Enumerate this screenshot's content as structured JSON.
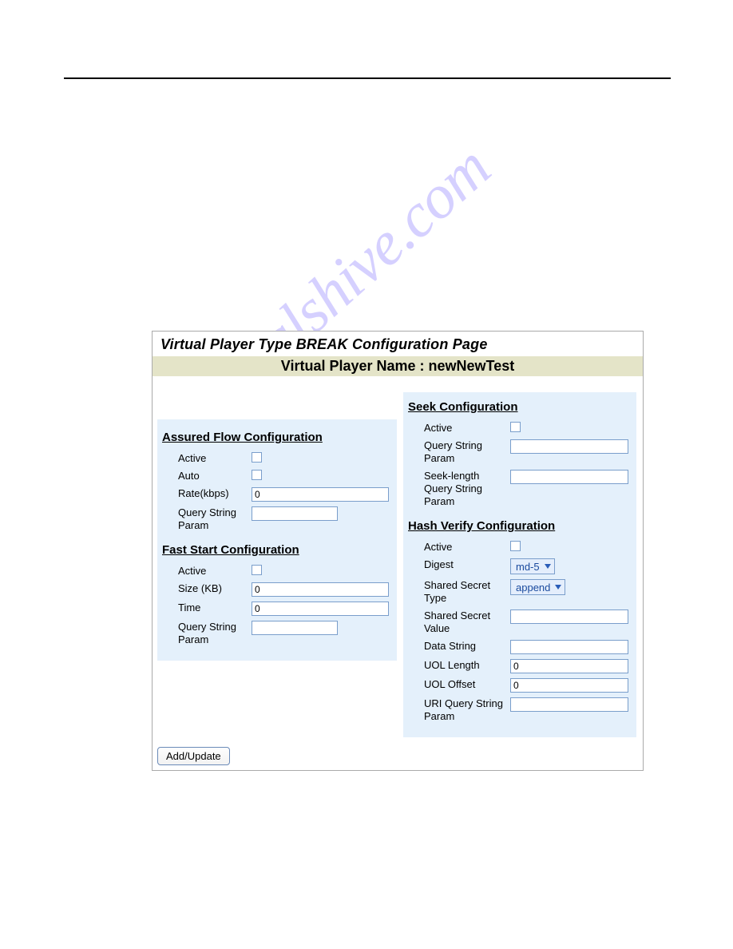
{
  "watermark": "manualshive.com",
  "panel": {
    "title": "Virtual Player Type BREAK Configuration Page",
    "player_name": "Virtual Player Name : newNewTest"
  },
  "assured": {
    "heading": "Assured Flow Configuration",
    "labels": {
      "active": "Active",
      "auto": "Auto",
      "rate": "Rate(kbps)",
      "qsp": "Query String Param"
    },
    "values": {
      "rate": "0",
      "qsp": ""
    }
  },
  "faststart": {
    "heading": "Fast Start Configuration",
    "labels": {
      "active": "Active",
      "size": "Size (KB)",
      "time": "Time",
      "qsp": "Query String Param"
    },
    "values": {
      "size": "0",
      "time": "0",
      "qsp": ""
    }
  },
  "seek": {
    "heading": "Seek Configuration",
    "labels": {
      "active": "Active",
      "qsp": "Query String Param",
      "slqsp": "Seek-length Query String Param"
    },
    "values": {
      "qsp": "",
      "slqsp": ""
    }
  },
  "hash": {
    "heading": "Hash Verify Configuration",
    "labels": {
      "active": "Active",
      "digest": "Digest",
      "sst": "Shared Secret Type",
      "ssv": "Shared Secret Value",
      "ds": "Data String",
      "uoll": "UOL Length",
      "uolo": "UOL Offset",
      "uriqsp": "URI Query String Param"
    },
    "values": {
      "digest": "md-5",
      "sst": "append",
      "ssv": "",
      "ds": "",
      "uoll": "0",
      "uolo": "0",
      "uriqsp": ""
    }
  },
  "buttons": {
    "add_update": "Add/Update"
  }
}
